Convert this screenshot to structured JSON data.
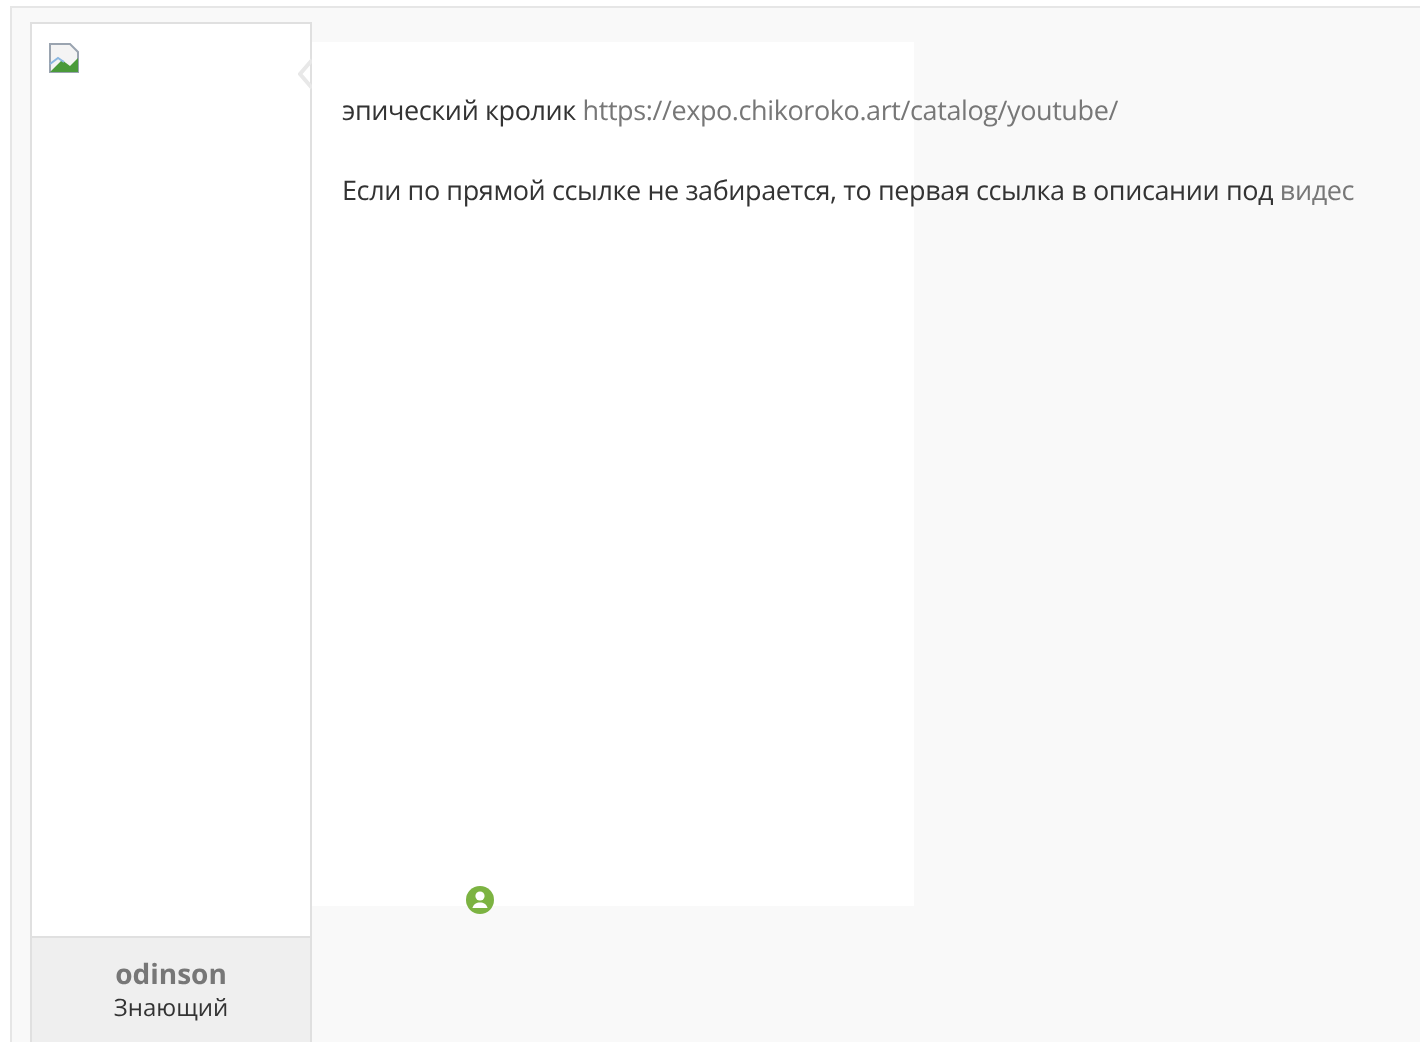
{
  "post": {
    "paragraphs": [
      {
        "text": "эпический кролик ",
        "link": "https://expo.chikoroko.art/catalog/youtube/"
      },
      {
        "text": "Если по прямой ссылке не забирается, то первая ссылка в описании под ",
        "link": "видес"
      }
    ]
  },
  "author": {
    "name": "odinson",
    "rank": "Знающий"
  }
}
